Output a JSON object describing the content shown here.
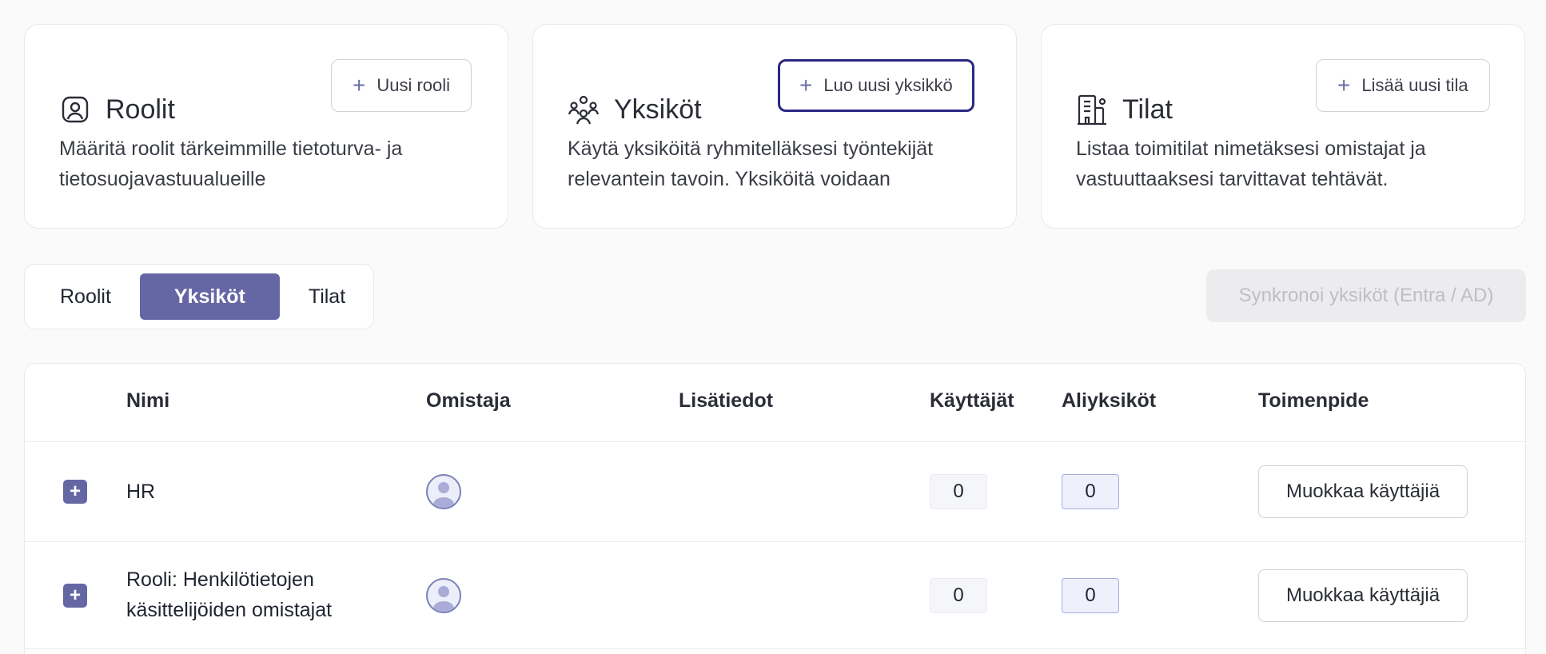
{
  "cards": [
    {
      "title": "Roolit",
      "icon": "user-badge-icon",
      "button_label": "Uusi rooli",
      "description": "Määritä roolit tärkeimmille tietoturva- ja tietosuojavastuualueille"
    },
    {
      "title": "Yksiköt",
      "icon": "group-icon",
      "button_label": "Luo uusi yksikkö",
      "description": "Käytä yksiköitä ryhmitelläksesi työntekijät relevantein tavoin. Yksiköitä voidaan"
    },
    {
      "title": "Tilat",
      "icon": "building-icon",
      "button_label": "Lisää uusi tila",
      "description": "Listaa toimitilat nimetäksesi omistajat ja vastuuttaaksesi tarvittavat tehtävät."
    }
  ],
  "tabs": [
    {
      "label": "Roolit",
      "active": false
    },
    {
      "label": "Yksiköt",
      "active": true
    },
    {
      "label": "Tilat",
      "active": false
    }
  ],
  "sync_button_label": "Synkronoi yksiköt (Entra / AD)",
  "table": {
    "columns": [
      "Nimi",
      "Omistaja",
      "Lisätiedot",
      "Käyttäjät",
      "Aliyksiköt",
      "Toimenpide"
    ],
    "rows": [
      {
        "name": "HR",
        "users": "0",
        "subunits": "0",
        "action": "Muokkaa käyttäjiä"
      },
      {
        "name": "Rooli: Henkilötietojen käsittelijöiden omistajat",
        "users": "0",
        "subunits": "0",
        "action": "Muokkaa käyttäjiä"
      }
    ]
  },
  "colors": {
    "accent": "#6567a5",
    "focus_border": "#2b2784",
    "background": "#fafafb"
  }
}
